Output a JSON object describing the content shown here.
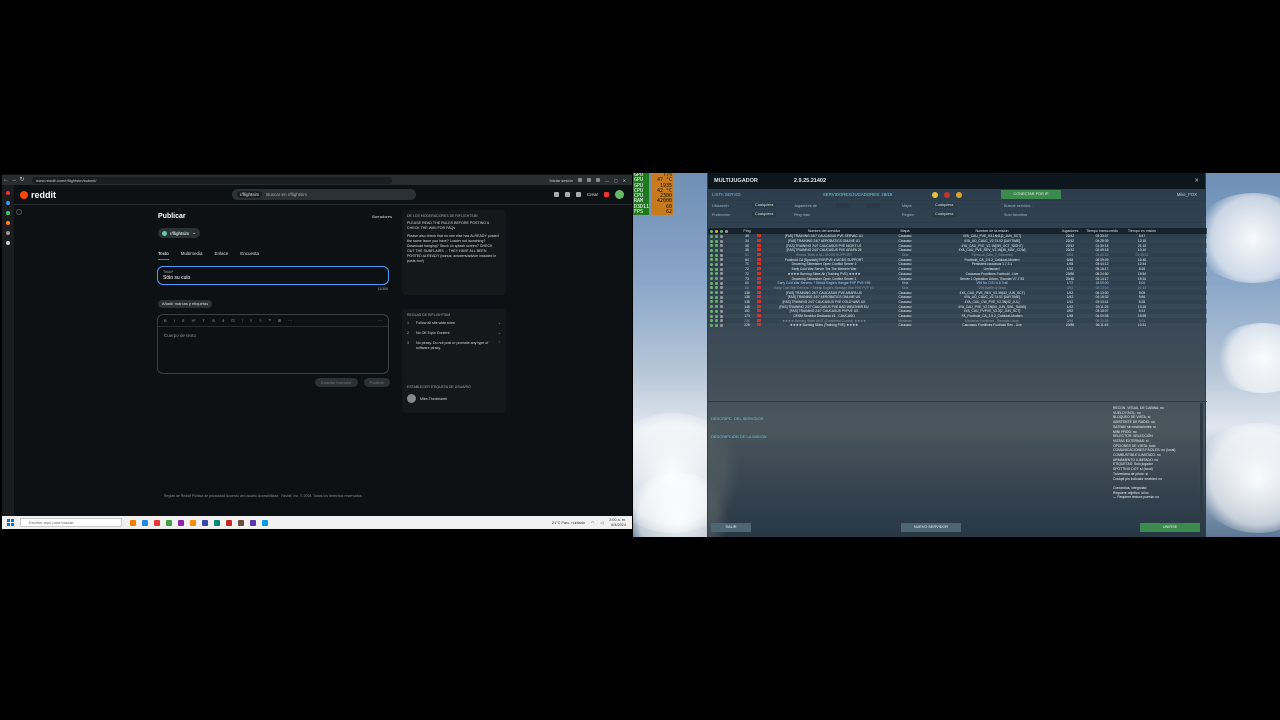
{
  "browser": {
    "url": "www.reddit.com/r/flightsim/submit/",
    "session_label": "Iniciar sesión",
    "logo_text": "reddit",
    "search_chip": "r/flightsim",
    "search_placeholder": "Buscar en r/flightsim",
    "create_label": "Crear"
  },
  "post": {
    "title": "Publicar",
    "drafts_label": "Borradores",
    "community": "r/flightsim",
    "tabs": [
      "Texto",
      "Multimedia",
      "Enlace",
      "Encuesta"
    ],
    "title_field_label": "Título*",
    "title_field_value": "Sólo su culo",
    "counter": "11/300",
    "tags_button": "Añadir marcas y etiquetas",
    "toolbar": [
      "B",
      "I",
      "S",
      "X²",
      "T",
      "⊘",
      "∂",
      "⊡",
      "⁝",
      "≡",
      "≡",
      "❝",
      "⊞",
      "⋯",
      "⊟",
      "⊠",
      "⊡"
    ],
    "more": "⋯",
    "body_placeholder": "Cuerpo de texto",
    "save_draft": "Guardar borrador",
    "publish": "Publicar"
  },
  "rules_box": {
    "heading": "DE LOS MODERADORES DE R/FLIGHTSIM",
    "para1": "PLEASE READ THE RULES BEFORE POSTING & CHECK THE WIKI FOR FAQs",
    "para2": "Please also check that no one else has ALREADY posted the same issue you have? Loader not launching? Download hanging? Stuck on splash screen? CHECK OUT THE SUBFLAIRS ... THEY HAVE ALL BEEN POSTED ALREADY (bonus: answers/advice included in posts too!)"
  },
  "rules_list": {
    "heading": "REGLAS DE R/FLIGHTSIM",
    "items": [
      {
        "n": "1",
        "text": "Follow all site wide rules"
      },
      {
        "n": "2",
        "text": "No Off-Topic Content"
      },
      {
        "n": "3",
        "text": "No piracy. Do not post or promote any type of software piracy."
      }
    ]
  },
  "user_flair": {
    "heading": "ESTABLECER ETIQUETA DE USUARIO",
    "username": "Mike-Thedreamb"
  },
  "footer": "Reglas de Reddit  Política de privacidad  Acuerdo del usuario  Accesibilidad  ·  Reddit, Inc. © 2024. Todos los derechos reservados.",
  "taskbar": {
    "search_placeholder": "Escribe aquí para buscar",
    "weather": "21°C  Parc. nublado",
    "time": "2:00 a. m.",
    "date": "6/4/2024",
    "app_colors": [
      "#f57c00",
      "#1e88e5",
      "#e53935",
      "#43a047",
      "#8e24aa",
      "#fb8c00",
      "#3949ab",
      "#00897b",
      "#c62828",
      "#6d4c41",
      "#5e35b1",
      "#039be5"
    ]
  },
  "game": {
    "stats": [
      {
        "k": "GPU",
        "v": "77%"
      },
      {
        "k": "GPU",
        "v": "47 °C"
      },
      {
        "k": "GPU",
        "v": "1935"
      },
      {
        "k": "CPU",
        "v": "42 °C"
      },
      {
        "k": "CPU",
        "v": "2300"
      },
      {
        "k": "RAM",
        "v": "42000"
      },
      {
        "k": "D3D11",
        "v": "60"
      },
      {
        "k": "FPS",
        "v": "62"
      }
    ],
    "window_title": "MULTIJUGADOR",
    "version": "2.9.25.21402",
    "close": "✕",
    "list_label": "LISTA SERVID.",
    "server_count": "SERVIDORES/JUGADORES: 28/19",
    "connect_ip": "CONECTAR POR IP",
    "user": "Mike_FOX",
    "filters": {
      "location_label": "Ubicación",
      "location_value": "Cualquiera",
      "players_label": "Jugadores de",
      "map_label": "Mapa",
      "map_value": "Cualquiera",
      "search_label": "Buscar servidor...",
      "protection_label": "Protección",
      "protection_value": "Cualquiera",
      "ping_label": "Ping máx.",
      "region_label": "Región",
      "region_value": "Cualquiera",
      "favorites_label": "Solo favoritos"
    },
    "columns": [
      "Ping",
      "",
      "Nombre del servidor",
      "Mapa",
      "Nombre de la misión",
      "Jugadores",
      "Tiempo transcurrido",
      "Tiempo en misión"
    ],
    "rows": [
      {
        "ping": "36",
        "name": "[FAS] TRAINING 24/7 CAUCASUS PVE SERVAC U1",
        "map": "Cáucaso",
        "mission": "4YA_CAU_PVE_V3.1N41[2_JUN_SCT]",
        "pl": "22/42",
        "tt": "03:33:07",
        "te": "8:47",
        "cls": ""
      },
      {
        "ping": "34",
        "name": "[FAS] TRAINING 24/7 AEROBATICS ONLINE U1",
        "map": "Cáucaso",
        "mission": "4YA_AO_CAUC_V2.74.02 [DAYTIME]",
        "pl": "22/42",
        "tt": "04:28:39",
        "te": "12:15",
        "cls": ""
      },
      {
        "ping": "36",
        "name": "[FAS] TRAINING 24/7 CAUCASUS PVE NIGHT U1",
        "map": "Cáucaso",
        "mission": "4YA_CAU_PVE_V2.1N[SN_OCT_NIGHT]",
        "pl": "22/42",
        "tt": "01:30:18",
        "te": "21:15",
        "cls": ""
      },
      {
        "ping": "36",
        "name": "[FAS] TRAINING 24/7 CAUCASUS PVE ARAPA 25",
        "map": "Cáucaso",
        "mission": "4YA_CAU_PVE_REV_V2.1N[45_MAY_CCW]",
        "pl": "20/42",
        "tt": "02:49:18",
        "te": "10:10",
        "cls": ""
      },
      {
        "ping": "51",
        "name": "Rhinos Team # ALL MODS SUPPORT",
        "map": "Siria",
        "mission": "Personal_Siria_2_Extended",
        "pl": "0/64",
        "tt": "03:40:52",
        "te": "01:45:02",
        "cls": "dim"
      },
      {
        "ping": "64",
        "name": "Footbold CA [Spanish] PVP/PVE # MODS SUPPORT",
        "map": "Cáucaso",
        "mission": "Footbold_CA_2.5.2_Caldurat-Modern",
        "pl": "6/48",
        "tt": "08:39:49",
        "te": "16:48",
        "cls": ""
      },
      {
        "ping": "71",
        "name": "Drowning Skirmisher Open Conflict Server 2",
        "map": "Cáucaso",
        "mission": "Persistent caucasus 1.7.3.1",
        "pl": "1/48",
        "tt": "03:44:12",
        "te": "12:44",
        "cls": ""
      },
      {
        "ping": "72",
        "name": "Early Cold War Server Tos The Mehrein War",
        "map": "Cáucaso",
        "mission": "Limitacion !",
        "pl": "1/32",
        "tt": "05:16:17",
        "te": "8:26",
        "cls": ""
      },
      {
        "ping": "72",
        "name": "★★★★ Burning Skies Air (Training PVE) ★★★★",
        "map": "Cáucaso",
        "mission": "Caucasus Frontlines Foothold - Live",
        "pl": "23/86",
        "tt": "05:24:50",
        "te": "15:54",
        "cls": ""
      },
      {
        "ping": "73",
        "name": "Drowning Skirmisher Open Conflict Server 1",
        "map": "Cáucaso",
        "mission": "Server 1 Operation Urban, Thunder V7.7.93",
        "pl": "20/48",
        "tt": "03:14:17",
        "te": "15:34",
        "cls": ""
      },
      {
        "ping": "85",
        "name": "Early Cold War Servers: * Streak Eagle's Hangar PVP PVE V96",
        "map": "Siria",
        "mission": "V96 No CIS Hi-6 Trail",
        "pl": "1/72",
        "tt": "18:09:00",
        "te": "8:00",
        "cls": "alt"
      },
      {
        "ping": "86",
        "name": "Early Cold War Servers: * Streak Eagle's Ramage War PVE PVP V3",
        "map": "Siria",
        "mission": "V96 Battle of Sinai",
        "pl": "0/52",
        "tt": "06:13:04",
        "te": "24:43",
        "cls": "dim"
      },
      {
        "ping": "136",
        "name": "[FAS] TRAINING 24/7 CAUCASUS PVE ARAPA US",
        "map": "Cáucaso",
        "mission": "4YA_CAU_PVE_REV_V2.3N[42_JUN_SCT]",
        "pl": "1/42",
        "tt": "04:13:00",
        "te": "9:09",
        "cls": ""
      },
      {
        "ping": "136",
        "name": "[FAS] TRAINING 24/7 AEROBATICS ONLINE US",
        "map": "Cáucaso",
        "mission": "4YA_AO_CAUC_V2.74.01 [DAYTIME]",
        "pl": "1/42",
        "tt": "04:16:32",
        "te": "9:56",
        "cls": ""
      },
      {
        "ping": "138",
        "name": "[FAS] TRAINING 24/7 CAUCASUS PVE COLD WAR UK",
        "map": "Cáucaso",
        "mission": "4YA_CAU_CW_PVE_V2.3N[42_JUL]",
        "pl": "1/42",
        "tt": "03:13:41",
        "te": "5:28",
        "cls": ""
      },
      {
        "ping": "148",
        "name": "[FAS] TRAINING 24/7 CAUCASUS PVE BAD WEATHER EU",
        "map": "Cáucaso",
        "mission": "4YA_CAU_PVE_V2.1N[04_JUN_SWL_SAND]",
        "pl": "1/42",
        "tt": "03:11:23",
        "te": "13:16",
        "cls": ""
      },
      {
        "ping": "152",
        "name": "[FAS] TRAINING 24/7 CAUCASUS PVPVE US",
        "map": "Cáucaso",
        "mission": "4YA_CAU_PVPVE_V2.3[2_JUN_SCT]",
        "pl": "2/52",
        "tt": "03:18:07",
        "te": "6:14",
        "cls": ""
      },
      {
        "ping": "173",
        "name": "CESM Servidor Dedicado #1 - CAUCASO",
        "map": "Cáucaso",
        "mission": "FA_Footbold_CA_2.5.2_Caldurat-Modern",
        "pl": "1/48",
        "tt": "04:00:08",
        "te": "15:55",
        "cls": ""
      },
      {
        "ping": "256",
        "name": "★★★★ Burning Skies UNIT (Combined Control) ★★★★",
        "map": "Marianas",
        "mission": "Marianas Frontlines - Remade Ulsan",
        "pl": "0/86",
        "tt": "08:20:35",
        "te": "9:01",
        "cls": "dim"
      },
      {
        "ping": "225",
        "name": "★★★★ Burning Skies (Training PVE) ★★★★",
        "map": "Cáucaso",
        "mission": "Caucasus Frontlines Foothold Rev - Live",
        "pl": "20/86",
        "tt": "06:11:49",
        "te": "10:31",
        "cls": ""
      }
    ],
    "desc_server": "DESCRIPC. DEL SERVIDOR",
    "desc_mission": "DESCRIPCIÓN DE LA MISIÓN",
    "server_info": [
      "RECON. VISUAL DE CABINA: no",
      "VUELO FÁCIL: no",
      "BLOQUEO DE VISTA: sí",
      "ASISTENTE DE RADIO: no",
      "SATNAV sin restricciones: sí",
      "MINI PROD: no",
      "SELECTOR: SELECCIÓN",
      "VISTAS EXTERNAS: sí",
      "OPCIONES DE VISTA: todo",
      "COMUNICACIONES FÁCILES: no (local)",
      "COMBUSTIBLE ILIMITADO: no",
      "ARMAMENTO ILIMITADO: no",
      "ETIQUETAS: Solo jugador",
      "SPOTTING DOT: sí (local)",
      "Tu/ventana de piloto: sí",
      "Cockpit pin indicator enabled: no",
      "",
      "Comandos, Integridad",
      "Requiere objetivo: sí/no",
      "— Requiere textura puesta: no"
    ],
    "btn_exit": "SALIR",
    "btn_new": "NUEVO SERVIDOR",
    "btn_join": "UNIRSE"
  }
}
